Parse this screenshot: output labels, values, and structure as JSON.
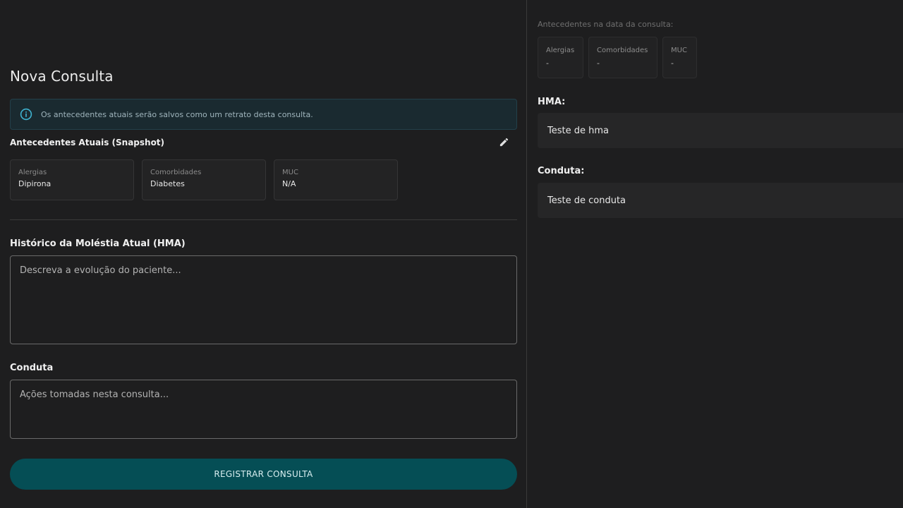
{
  "colors": {
    "background": "#1e1e1f",
    "accent_button": "#054e55",
    "info_icon": "#3fb3d0"
  },
  "left": {
    "title": "Nova Consulta",
    "info_alert": {
      "icon": "info-icon",
      "text": "Os antecedentes atuais serão salvos como um retrato desta consulta."
    },
    "snapshot": {
      "title": "Antecedentes Atuais (Snapshot)",
      "edit_icon": "pencil-icon",
      "cards": [
        {
          "label": "Alergias",
          "value": "Dipirona"
        },
        {
          "label": "Comorbidades",
          "value": "Diabetes"
        },
        {
          "label": "MUC",
          "value": "N/A"
        }
      ]
    },
    "hma": {
      "label": "Histórico da Moléstia Atual (HMA)",
      "placeholder": "Descreva a evolução do paciente...",
      "value": ""
    },
    "conduta": {
      "label": "Conduta",
      "placeholder": "Ações tomadas nesta consulta...",
      "value": ""
    },
    "submit_label": "REGISTRAR CONSULTA"
  },
  "right": {
    "caption": "Antecedentes na data da consulta:",
    "cards": [
      {
        "label": "Alergias",
        "value": "-"
      },
      {
        "label": "Comorbidades",
        "value": "-"
      },
      {
        "label": "MUC",
        "value": "-"
      }
    ],
    "hma_label": "HMA:",
    "hma_value": "Teste de hma",
    "conduta_label": "Conduta:",
    "conduta_value": "Teste de conduta"
  }
}
